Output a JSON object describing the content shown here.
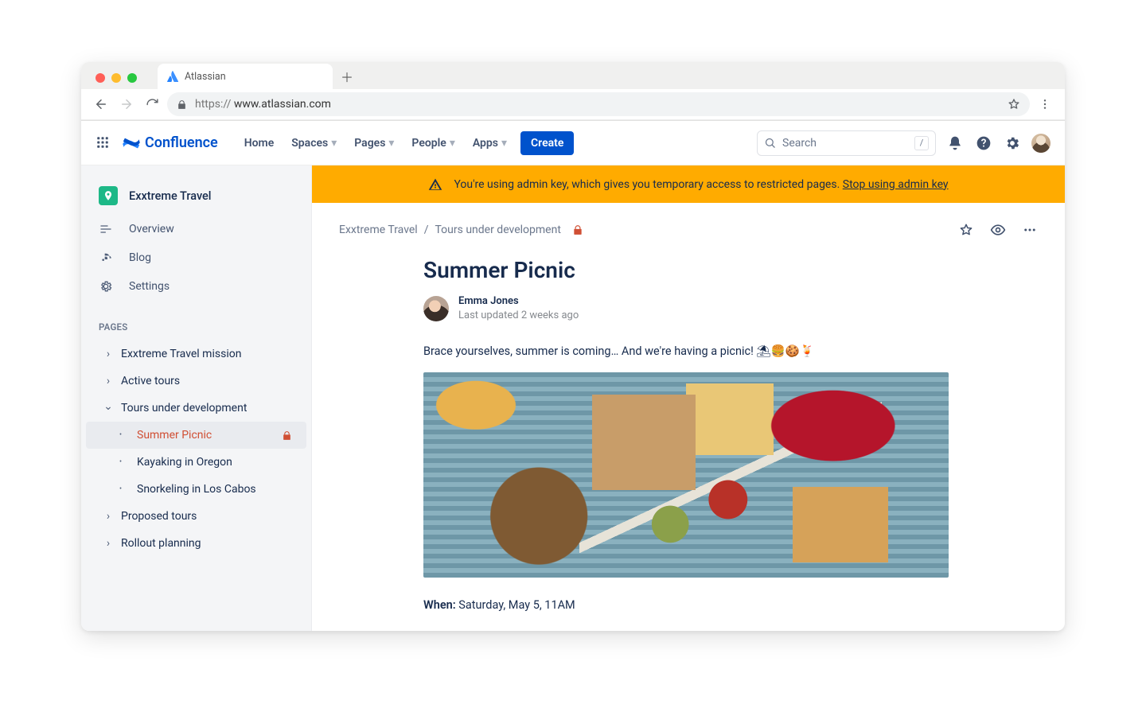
{
  "browser": {
    "tab_title": "Atlassian",
    "url_prefix": "https:// ",
    "url": "www.atlassian.com"
  },
  "app_header": {
    "product_name": "Confluence",
    "nav": {
      "home": "Home",
      "spaces": "Spaces",
      "pages": "Pages",
      "people": "People",
      "apps": "Apps"
    },
    "create_label": "Create",
    "search_placeholder": "Search",
    "search_shortcut": "/"
  },
  "banner": {
    "text": "You're using admin key, which gives you temporary access to restricted pages. ",
    "link_text": "Stop using admin key"
  },
  "sidebar": {
    "space_name": "Exxtreme Travel",
    "links": {
      "overview": "Overview",
      "blog": "Blog",
      "settings": "Settings"
    },
    "pages_heading": "PAGES",
    "tree": {
      "mission": "Exxtreme Travel mission",
      "active_tours": "Active tours",
      "tours_dev": "Tours under development",
      "summer_picnic": "Summer Picnic",
      "kayaking": "Kayaking in Oregon",
      "snorkeling": "Snorkeling in Los Cabos",
      "proposed": "Proposed tours",
      "rollout": "Rollout planning"
    }
  },
  "breadcrumb": {
    "space": "Exxtreme Travel",
    "sep": " / ",
    "parent": "Tours under development"
  },
  "article": {
    "title": "Summer Picnic",
    "author": "Emma Jones",
    "subline": "Last updated 2 weeks ago",
    "intro": "Brace yourselves, summer is coming… And we're having a picnic! ⛱🍔🍪🍹",
    "when_label": "When:",
    "when_value": " Saturday, May 5, 11AM"
  }
}
